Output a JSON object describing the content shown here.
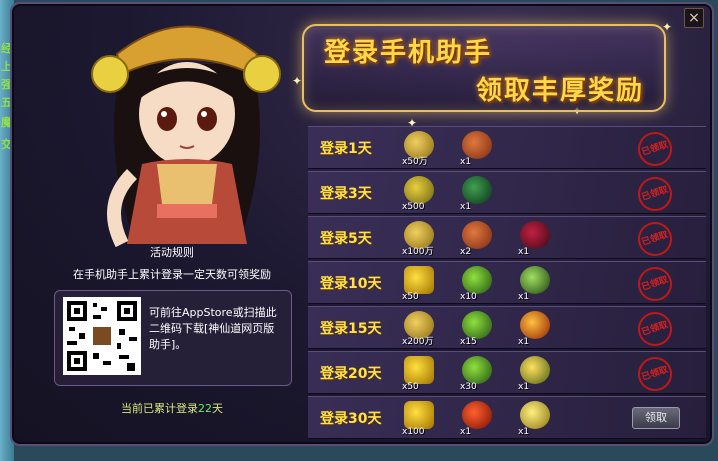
{
  "banner": {
    "line1": "登录手机助手",
    "line2": "领取丰厚奖励"
  },
  "rules": {
    "title": "活动规则",
    "line": "在手机助手上累计登录一定天数可领奖励",
    "qr_text": "可前往AppStore或扫描此二维码下载[神仙道网页版助手]。"
  },
  "progress": {
    "prefix": "当前已累计登录",
    "days": "22",
    "suffix": "天"
  },
  "rewards": [
    {
      "day": "登录1天",
      "items": [
        {
          "icon": "coin-icon",
          "qty": "x50万"
        },
        {
          "icon": "roast-meat-icon",
          "qty": "x1"
        }
      ],
      "status": "已领取"
    },
    {
      "day": "登录3天",
      "items": [
        {
          "icon": "coin-icon",
          "qty": "x500"
        },
        {
          "icon": "leaf-herb-icon",
          "qty": "x1"
        }
      ],
      "status": "已领取"
    },
    {
      "day": "登录5天",
      "items": [
        {
          "icon": "coin-icon",
          "qty": "x100万"
        },
        {
          "icon": "roast-meat-icon",
          "qty": "x2"
        },
        {
          "icon": "berry-bowl-icon",
          "qty": "x1"
        }
      ],
      "status": "已领取"
    },
    {
      "day": "登录10天",
      "items": [
        {
          "icon": "gold-ingot-icon",
          "qty": "x50"
        },
        {
          "icon": "yin-yang-icon",
          "qty": "x10"
        },
        {
          "icon": "green-gem-icon",
          "qty": "x1"
        }
      ],
      "status": "已领取"
    },
    {
      "day": "登录15天",
      "items": [
        {
          "icon": "coin-icon",
          "qty": "x200万"
        },
        {
          "icon": "yin-yang-icon",
          "qty": "x15"
        },
        {
          "icon": "fire-egg-icon",
          "qty": "x1"
        }
      ],
      "status": "已领取"
    },
    {
      "day": "登录20天",
      "items": [
        {
          "icon": "gold-ingot-icon",
          "qty": "x50"
        },
        {
          "icon": "yin-yang-icon",
          "qty": "x30"
        },
        {
          "icon": "treasure-bowl-icon",
          "qty": "x1"
        }
      ],
      "status": "已领取"
    },
    {
      "day": "登录30天",
      "items": [
        {
          "icon": "gold-ingot-icon",
          "qty": "x100"
        },
        {
          "icon": "red-chest-icon",
          "qty": "x1"
        },
        {
          "icon": "gold-orb-icon",
          "qty": "x1"
        }
      ],
      "status": "领取"
    }
  ],
  "close_label": "×",
  "edge_text": [
    "经",
    "上",
    "强",
    "五",
    "魔",
    "交"
  ]
}
